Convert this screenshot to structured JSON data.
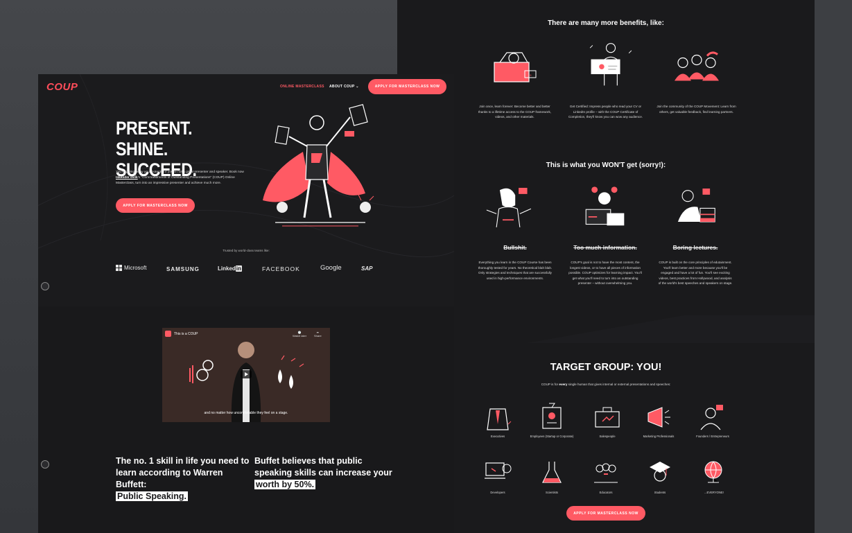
{
  "nav": {
    "logo": "COUP",
    "online_masterclass": "ONLINE MASTERCLASS",
    "about": "ABOUT COUP ⌄",
    "apply": "APPLY FOR MASTERCLASS NOW"
  },
  "hero": {
    "title_line1": "PRESENT. SHINE.",
    "title_line2": "SUCCEED.",
    "desc_1": "You're giving away your potential if you're not a great presenter and speaker. Book now ",
    "desc_name": "Iskender Dirik",
    "desc_2": "'s \"Commandments of Outstanding Presentations\" (COUP) Online Masterclass, turn into an impressive presenter and achieve much more.",
    "apply": "APPLY FOR MASTERCLASS NOW"
  },
  "trusted": {
    "label": "Trusted by world-class teams like:",
    "brands": [
      "Microsoft",
      "SAMSUNG",
      "Linked",
      "in",
      "FACEBOOK",
      "Google",
      "SAP"
    ]
  },
  "video": {
    "title": "This is a COUP",
    "watch_later": "Watch later",
    "share": "Share",
    "caption": "and no matter how uncomfortable they feel on a stage."
  },
  "quotes": {
    "q1_line1": "The no. 1 skill in life you need to",
    "q1_line2": "learn according to Warren Buffett:",
    "q1_highlight": "Public Speaking.",
    "q2_line1": "Buffet believes that public",
    "q2_line2": "speaking skills can increase your",
    "q2_highlight": "worth by 50%."
  },
  "benefits": {
    "title": "There are many more benefits, like:",
    "items": [
      "Join once, learn forever: Become better and better thanks to a lifetime access to the COUP framework, videos, and other materials.",
      "Get Certified: Impress people who read your CV or LinkedIn profile – with the COUP Certificate of Completion, they'll know you can wow any audience.",
      "Join the community of the COUP Movement: Learn from others, get valuable feedback, find learning partners."
    ]
  },
  "wont_get": {
    "title": "This is what you WON'T get (sorry!):",
    "items": [
      {
        "head": "Bullshit.",
        "text": "Everything you learn in the COUP Course has been thoroughly tested for years. No theoretical blah blah. Only strategies and techniques that are successfully used in high-performance environments."
      },
      {
        "head": "Too much information.",
        "text": "COUP's goal is not to have the most content, the longest videos, or to have all pieces of information possible. COUP optimizes for learning impact. You'll get what you'll need to turn into an outstanding presenter – without overwhelming you."
      },
      {
        "head": "Boring lectures.",
        "text": "COUP is built on the core principles of edutainment. You'll learn better and more because you'll be engaged and have a lot of fun. You'll see exciting videos, best practices from Hollywood, and analysis of the world's best speeches and speakers on stage."
      }
    ]
  },
  "target": {
    "title": "TARGET GROUP: YOU!",
    "desc_1": "COUP is for ",
    "desc_bold": "every",
    "desc_2": " single human that gives internal or external presentations and speeches:",
    "groups": [
      "Executives",
      "Employees (Startup or Corporate)",
      "Salespeople",
      "Marketing Professionals",
      "Founders / Entrepreneurs",
      "Developers",
      "Scientists",
      "Educators",
      "Students",
      "...EVERYONE!"
    ],
    "apply": "APPLY FOR MASTERCLASS NOW"
  },
  "colors": {
    "accent": "#ff5a64",
    "page_bg": "#19191b",
    "outer_bg": "#3a3c40"
  }
}
